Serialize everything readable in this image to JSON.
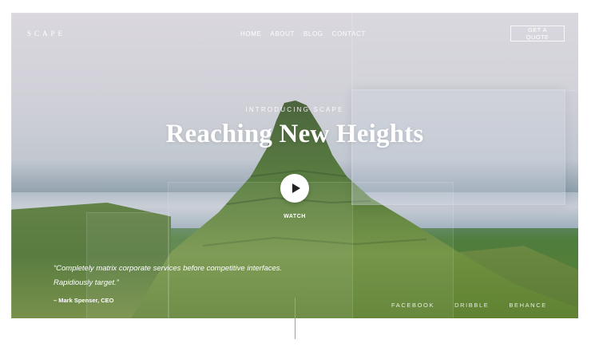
{
  "brand": {
    "logo": "SCAPE"
  },
  "nav": {
    "items": [
      {
        "label": "HOME",
        "active": true
      },
      {
        "label": "ABOUT",
        "active": false
      },
      {
        "label": "BLOG",
        "active": false
      },
      {
        "label": "CONTACT",
        "active": false
      }
    ],
    "cta_label": "GET A QUOTE"
  },
  "hero": {
    "eyebrow": "INTRODUCING SCAPE",
    "headline": "Reaching New Heights",
    "watch_label": "WATCH"
  },
  "testimonial": {
    "quote": "“Completely matrix corporate services before competitive interfaces. Rapidiously target.”",
    "author": "– Mark Spenser, CEO"
  },
  "social": {
    "links": [
      {
        "label": "FACEBOOK"
      },
      {
        "label": "DRIBBLE"
      },
      {
        "label": "BEHANCE"
      }
    ]
  },
  "colors": {
    "accent_line": "#b79a83",
    "text": "#ffffff",
    "play_button": "#ffffff"
  },
  "icons": {
    "play": "play-icon"
  }
}
